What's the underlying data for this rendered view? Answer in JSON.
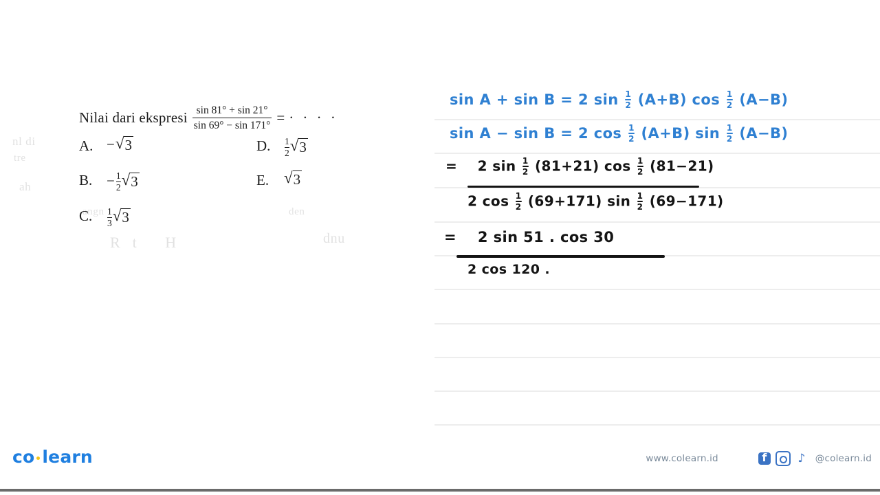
{
  "question": {
    "stem_text": "Nilai dari ekspresi",
    "fraction": {
      "numerator": "sin 81° + sin 21°",
      "denominator": "sin 69° − sin 171°"
    },
    "equals": "=",
    "dots": "· · · ·",
    "options": [
      {
        "label": "A.",
        "sign": "−",
        "frac_num": "",
        "frac_den": "",
        "radical": "√",
        "radicand": "3",
        "plain": "−√3"
      },
      {
        "label": "B.",
        "sign": "−",
        "frac_num": "1",
        "frac_den": "2",
        "radical": "√",
        "radicand": "3",
        "plain": "−(1/2)√3"
      },
      {
        "label": "C.",
        "sign": "",
        "frac_num": "1",
        "frac_den": "3",
        "radical": "√",
        "radicand": "3",
        "plain": "(1/3)√3"
      },
      {
        "label": "D.",
        "sign": "",
        "frac_num": "1",
        "frac_den": "2",
        "radical": "√",
        "radicand": "3",
        "plain": "(1/2)√3"
      },
      {
        "label": "E.",
        "sign": "",
        "frac_num": "",
        "frac_den": "",
        "radical": "√",
        "radicand": "3",
        "plain": "√3"
      }
    ],
    "ghost_text": [
      "nl  di",
      "tre",
      "ah",
      "angn",
      "den",
      "Rt  H",
      "dnu"
    ]
  },
  "working": {
    "formula_1": {
      "lhs": "sin A + sin B =",
      "rhs_a": "2 sin",
      "half_num": "1",
      "half_den": "2",
      "rhs_b": "(A+B) cos",
      "rhs_c": "(A−B)"
    },
    "formula_2": {
      "lhs": "sin A − sin B =",
      "rhs_a": "2 cos",
      "half_num": "1",
      "half_den": "2",
      "rhs_b": "(A+B) sin",
      "rhs_c": "(A−B)"
    },
    "step_2": {
      "equals": "=",
      "numerator_a": "2 sin",
      "numerator_b": "(81+21) cos",
      "numerator_c": "(81−21)",
      "denominator_a": "2 cos",
      "denominator_b": "(69+171) sin",
      "denominator_c": "(69−171)",
      "half_num": "1",
      "half_den": "2"
    },
    "step_3": {
      "equals": "=",
      "numerator": "2 sin 51 . cos 30",
      "denominator": "2 cos 120 ."
    },
    "ruled_line_tops": [
      173,
      222,
      272,
      322,
      371,
      420,
      470,
      519,
      568,
      617
    ],
    "ink_blue": "#2f80d2",
    "ink_black": "#141414",
    "rule_color": "#ededed"
  },
  "footer": {
    "brand_left": "co",
    "brand_right": "learn",
    "website": "www.colearn.id",
    "handle": "@colearn.id",
    "social": [
      "facebook-icon",
      "instagram-icon",
      "tiktok-icon"
    ],
    "brand_color": "#1f7fe0",
    "dot_color": "#f5c518"
  }
}
